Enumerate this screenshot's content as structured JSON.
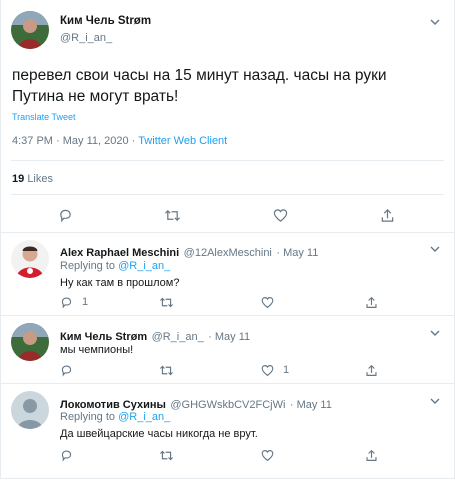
{
  "main_tweet": {
    "name": "Ким Чель Strøm",
    "handle": "@R_i_an_",
    "text_line1": "перевел свои часы на 15 минут назад. часы на руки",
    "text_line2": "Путина не могут врать!",
    "translate": "Translate Tweet",
    "time": "4:37 PM · May 11, 2020",
    "separator": "·",
    "client": "Twitter Web Client",
    "likes_count": "19",
    "likes_label": "Likes"
  },
  "replies": [
    {
      "name": "Alex Raphael Meschini",
      "handle": "@12AlexMeschini",
      "date": "· May 11",
      "replying_prefix": "Replying to",
      "replying_to": "@R_i_an_",
      "text": "Ну как там в прошлом?",
      "reply_count": "1",
      "like_count": ""
    },
    {
      "name": "Ким Чель Strøm",
      "handle": "@R_i_an_",
      "date": "· May 11",
      "replying_prefix": "",
      "replying_to": "",
      "text": "мы чемпионы!",
      "reply_count": "",
      "like_count": "1"
    },
    {
      "name": "Локомотив Сухины",
      "handle": "@GHGWskbCV2FCjWi",
      "date": "· May 11",
      "replying_prefix": "Replying to",
      "replying_to": "@R_i_an_",
      "text": "Да швейцарские часы никогда не врут.",
      "reply_count": "",
      "like_count": ""
    }
  ],
  "colors": {
    "accent": "#1da1f2",
    "muted": "#657786",
    "border": "#e6ecf0"
  }
}
